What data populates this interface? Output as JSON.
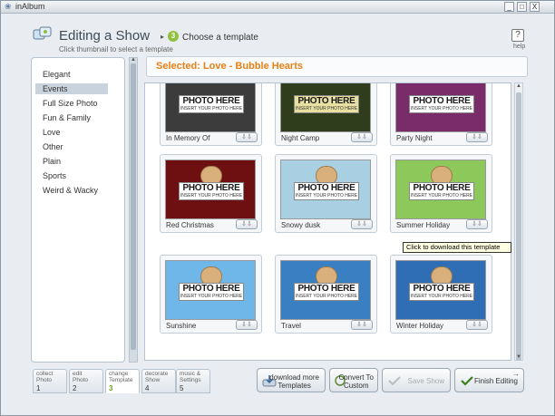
{
  "window": {
    "app_title": "inAlbum",
    "controls": {
      "minimize": "_",
      "maximize": "□",
      "close": "X"
    }
  },
  "header": {
    "title": "Editing a Show",
    "step_number": "3",
    "step_label": "Choose a template",
    "subtitle": "Click thumbnail to select a template",
    "help_icon_text": "?",
    "help_label": "help"
  },
  "categories": [
    {
      "label": "Elegant",
      "selected": false
    },
    {
      "label": "Events",
      "selected": true
    },
    {
      "label": "Full Size Photo",
      "selected": false
    },
    {
      "label": "Fun & Family",
      "selected": false
    },
    {
      "label": "Love",
      "selected": false
    },
    {
      "label": "Other",
      "selected": false
    },
    {
      "label": "Plain",
      "selected": false
    },
    {
      "label": "Sports",
      "selected": false
    },
    {
      "label": "Weird & Wacky",
      "selected": false
    }
  ],
  "selection": {
    "text": "Selected: Love - Bubble Hearts"
  },
  "placeholder": {
    "big": "PHOTO HERE",
    "small": "INSERT YOUR PHOTO HERE"
  },
  "templates": [
    {
      "label": "In Memory Of",
      "bg": "#3c3c3c"
    },
    {
      "label": "Night Camp",
      "bg": "#2f3d1c"
    },
    {
      "label": "Party Night",
      "bg": "#7a2c6a"
    },
    {
      "label": "Red Christmas",
      "bg": "#6e0f12"
    },
    {
      "label": "Snowy dusk",
      "bg": "#a9cfe3"
    },
    {
      "label": "Summer Holiday",
      "bg": "#8cc95a"
    },
    {
      "label": "Sunshine",
      "bg": "#6fb7e8"
    },
    {
      "label": "Travel",
      "bg": "#3a7fc1"
    },
    {
      "label": "Winter Holiday",
      "bg": "#2f6db5"
    }
  ],
  "download_icon": "⇩⇩",
  "tooltip": {
    "text": "Click to download this template"
  },
  "steps": [
    {
      "label": "collect\nPhoto",
      "num": "1"
    },
    {
      "label": "edit\nPhoto",
      "num": "2"
    },
    {
      "label": "change\nTemplate",
      "num": "3"
    },
    {
      "label": "decorate\nShow",
      "num": "4"
    },
    {
      "label": "music &\nSettings",
      "num": "5"
    }
  ],
  "actions": {
    "download_more": "download more\nTemplates",
    "convert": "Convert To\nCustom",
    "save_show": "Save Show",
    "finish": "Finish Editing"
  },
  "colors": {
    "accent_orange": "#ea7f14",
    "step_green": "#8fc13e"
  }
}
